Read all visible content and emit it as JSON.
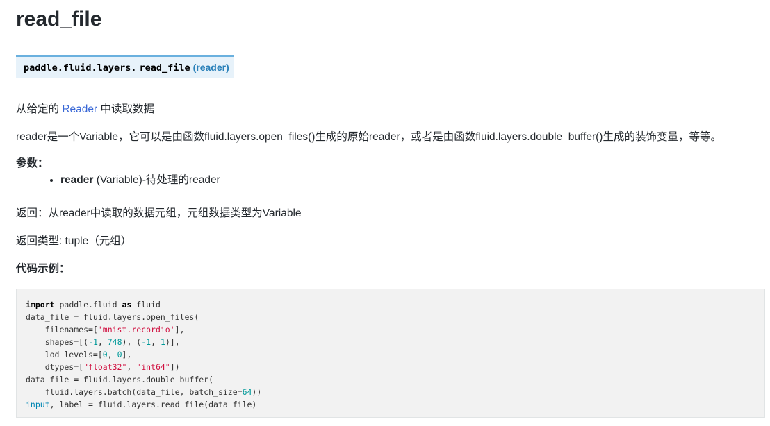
{
  "page": {
    "title": "read_file",
    "signature": {
      "module": "paddle.fluid.layers.",
      "name": "read_file",
      "params": "(reader)"
    },
    "description": {
      "prefix": "从给定的",
      "reference": "Reader",
      "suffix": "中读取数据"
    },
    "detail": "reader是一个Variable，它可以是由函数fluid.layers.open_files()生成的原始reader，或者是由函数fluid.layers.double_buffer()生成的装饰变量，等等。",
    "params_label": "参数：",
    "params": [
      {
        "name": "reader",
        "desc": " (Variable)-待处理的reader"
      }
    ],
    "returns": "返回：从reader中读取的数据元组，元组数据类型为Variable",
    "return_type": "返回类型: tuple（元组）",
    "example_label": "代码示例："
  },
  "code": {
    "lines": [
      [
        {
          "t": "import",
          "c": "kw"
        },
        {
          "t": " paddle.fluid ",
          "c": ""
        },
        {
          "t": "as",
          "c": "kw"
        },
        {
          "t": " fluid",
          "c": ""
        }
      ],
      [
        {
          "t": "data_file = fluid.layers.open_files(",
          "c": ""
        }
      ],
      [
        {
          "t": "    filenames=[",
          "c": ""
        },
        {
          "t": "'mnist.recordio'",
          "c": "st"
        },
        {
          "t": "],",
          "c": ""
        }
      ],
      [
        {
          "t": "    shapes=[(",
          "c": ""
        },
        {
          "t": "-1",
          "c": "nm"
        },
        {
          "t": ", ",
          "c": ""
        },
        {
          "t": "748",
          "c": "nm"
        },
        {
          "t": "), (",
          "c": ""
        },
        {
          "t": "-1",
          "c": "nm"
        },
        {
          "t": ", ",
          "c": ""
        },
        {
          "t": "1",
          "c": "nm"
        },
        {
          "t": ")],",
          "c": ""
        }
      ],
      [
        {
          "t": "    lod_levels=[",
          "c": ""
        },
        {
          "t": "0",
          "c": "nm"
        },
        {
          "t": ", ",
          "c": ""
        },
        {
          "t": "0",
          "c": "nm"
        },
        {
          "t": "],",
          "c": ""
        }
      ],
      [
        {
          "t": "    dtypes=[",
          "c": ""
        },
        {
          "t": "\"float32\"",
          "c": "st"
        },
        {
          "t": ", ",
          "c": ""
        },
        {
          "t": "\"int64\"",
          "c": "st"
        },
        {
          "t": "])",
          "c": ""
        }
      ],
      [
        {
          "t": "data_file = fluid.layers.double_buffer(",
          "c": ""
        }
      ],
      [
        {
          "t": "    fluid.layers.batch(data_file, batch_size=",
          "c": ""
        },
        {
          "t": "64",
          "c": "nm"
        },
        {
          "t": "))",
          "c": ""
        }
      ],
      [
        {
          "t": "input",
          "c": "bi"
        },
        {
          "t": ", label = fluid.layers.read_file(data_file)",
          "c": ""
        }
      ]
    ]
  }
}
